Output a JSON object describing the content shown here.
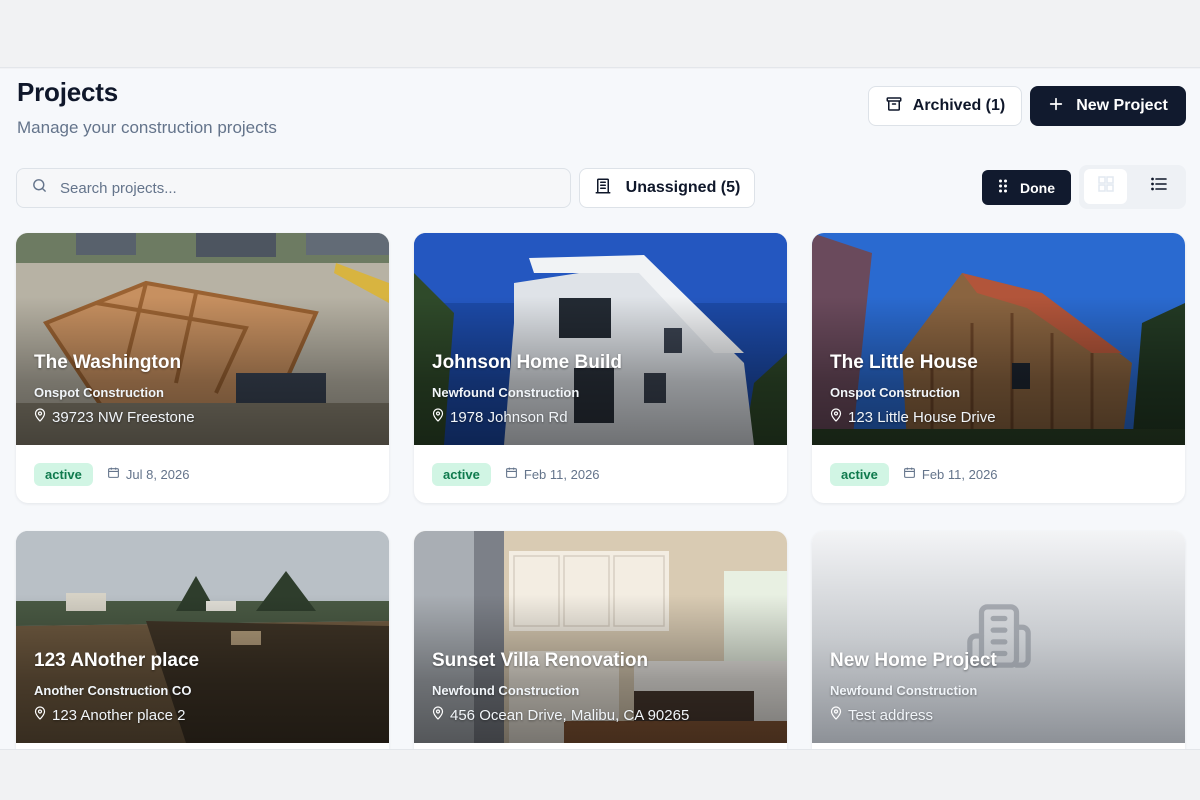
{
  "header": {
    "title": "Projects",
    "subtitle": "Manage your construction projects",
    "archived_label": "Archived (1)",
    "new_project_label": "New Project"
  },
  "toolbar": {
    "search_placeholder": "Search projects...",
    "unassigned_label": "Unassigned (5)",
    "done_label": "Done"
  },
  "projects": [
    {
      "title": "The Washington",
      "company": "Onspot Construction",
      "address": "39723 NW Freestone",
      "status": "active",
      "date": "Jul 8, 2026"
    },
    {
      "title": "Johnson Home Build",
      "company": "Newfound Construction",
      "address": "1978 Johnson Rd",
      "status": "active",
      "date": "Feb 11, 2026"
    },
    {
      "title": "The Little House",
      "company": "Onspot Construction",
      "address": "123 Little House Drive",
      "status": "active",
      "date": "Feb 11, 2026"
    },
    {
      "title": "123 ANother place",
      "company": "Another Construction CO",
      "address": "123 Another place 2"
    },
    {
      "title": "Sunset Villa Renovation",
      "company": "Newfound Construction",
      "address": "456 Ocean Drive, Malibu, CA 90265"
    },
    {
      "title": "New Home Project",
      "company": "Newfound Construction",
      "address": "Test address"
    }
  ],
  "colors": {
    "primary_dark": "#111a2e",
    "badge_bg": "#d1f5e4",
    "badge_text": "#0f7a4d",
    "muted_text": "#64748b"
  },
  "icons": [
    "archive-icon",
    "plus-icon",
    "search-icon",
    "building-icon",
    "grip-icon",
    "grid-view-icon",
    "list-view-icon",
    "map-pin-icon",
    "calendar-icon"
  ]
}
